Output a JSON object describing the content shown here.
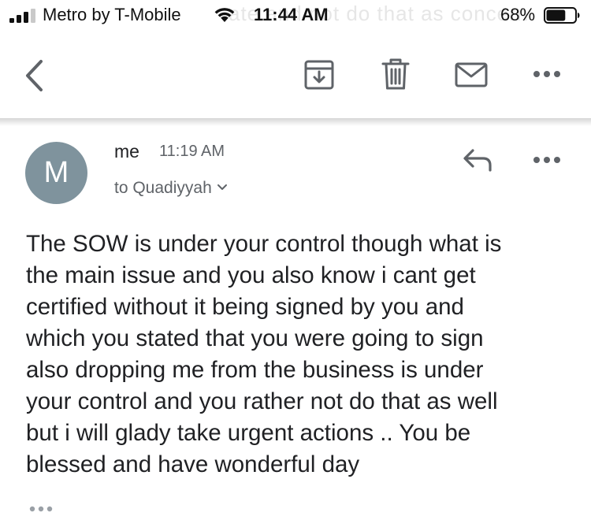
{
  "status_bar": {
    "carrier": "Metro by T-Mobile",
    "time": "11:44 AM",
    "battery_percent": "68%",
    "battery_level": 0.68,
    "ghost_text": "ate and not do that as concern",
    "signal_icon": "cellular-signal-icon",
    "wifi_icon": "wifi-icon",
    "battery_icon": "battery-icon"
  },
  "toolbar": {
    "back_icon": "chevron-left-icon",
    "archive_icon": "archive-icon",
    "delete_icon": "trash-icon",
    "mark_unread_icon": "envelope-icon",
    "more_icon": "more-horizontal-icon"
  },
  "message": {
    "avatar_letter": "M",
    "sender": "me",
    "time": "11:19 AM",
    "recipient": "to Quadiyyah",
    "reply_icon": "reply-icon",
    "more_icon": "more-horizontal-icon",
    "expand_icon": "chevron-down-icon",
    "body_lines": [
      "The SOW is under your control though what is",
      "the main issue and you also know i cant get",
      "certified without it being signed by you and",
      "which you stated that you were going to sign",
      "also dropping me from the business is under",
      "your control and you rather not do that as well",
      "but i will glady take urgent actions .. You be",
      "blessed and have wonderful day"
    ],
    "trimmed_icon": "show-trimmed-content-icon"
  },
  "colors": {
    "avatar_bg": "#7f939d",
    "text_primary": "#202124",
    "text_secondary": "#5f6368",
    "icon_gray": "#5f6368"
  }
}
